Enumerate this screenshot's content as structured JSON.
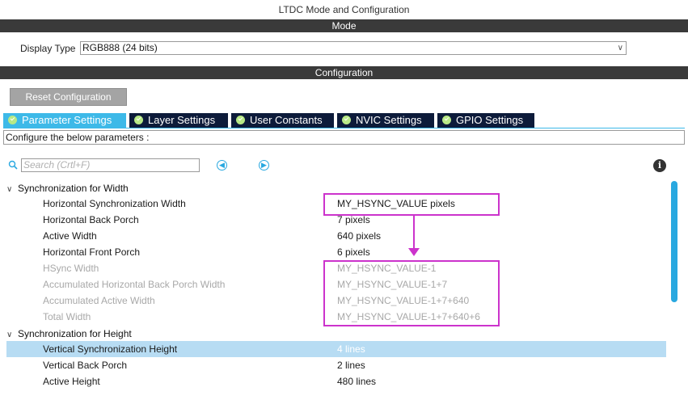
{
  "window_title": "LTDC Mode and Configuration",
  "mode_header": "Mode",
  "display_type": {
    "label": "Display Type",
    "value": "RGB888 (24 bits)"
  },
  "configuration_header": "Configuration",
  "reset_button": "Reset Configuration",
  "tabs": [
    {
      "label": "Parameter Settings",
      "active": true
    },
    {
      "label": "Layer Settings"
    },
    {
      "label": "User Constants"
    },
    {
      "label": "NVIC Settings"
    },
    {
      "label": "GPIO Settings"
    }
  ],
  "configure_text": "Configure the below parameters :",
  "search": {
    "placeholder": "Search (Crtl+F)"
  },
  "groups": [
    {
      "title": "Synchronization for Width",
      "params": [
        {
          "name": "Horizontal Synchronization Width",
          "value": "MY_HSYNC_VALUE pixels"
        },
        {
          "name": "Horizontal Back Porch",
          "value": "7 pixels"
        },
        {
          "name": "Active Width",
          "value": "640 pixels"
        },
        {
          "name": "Horizontal Front Porch",
          "value": "6 pixels"
        },
        {
          "name": "HSync Width",
          "value": "MY_HSYNC_VALUE-1",
          "disabled": true
        },
        {
          "name": "Accumulated Horizontal Back Porch Width",
          "value": "MY_HSYNC_VALUE-1+7",
          "disabled": true
        },
        {
          "name": "Accumulated Active Width",
          "value": "MY_HSYNC_VALUE-1+7+640",
          "disabled": true
        },
        {
          "name": "Total Width",
          "value": "MY_HSYNC_VALUE-1+7+640+6",
          "disabled": true
        }
      ]
    },
    {
      "title": "Synchronization for Height",
      "params": [
        {
          "name": "Vertical Synchronization Height",
          "value": "4 lines",
          "selected": true
        },
        {
          "name": "Vertical Back Porch",
          "value": "2 lines"
        },
        {
          "name": "Active Height",
          "value": "480 lines"
        }
      ]
    }
  ],
  "colors": {
    "accent": "#3db9e8",
    "tab_bg": "#0d1b3a",
    "highlight": "#cc33cc",
    "selected_row": "#b7dcf3"
  }
}
